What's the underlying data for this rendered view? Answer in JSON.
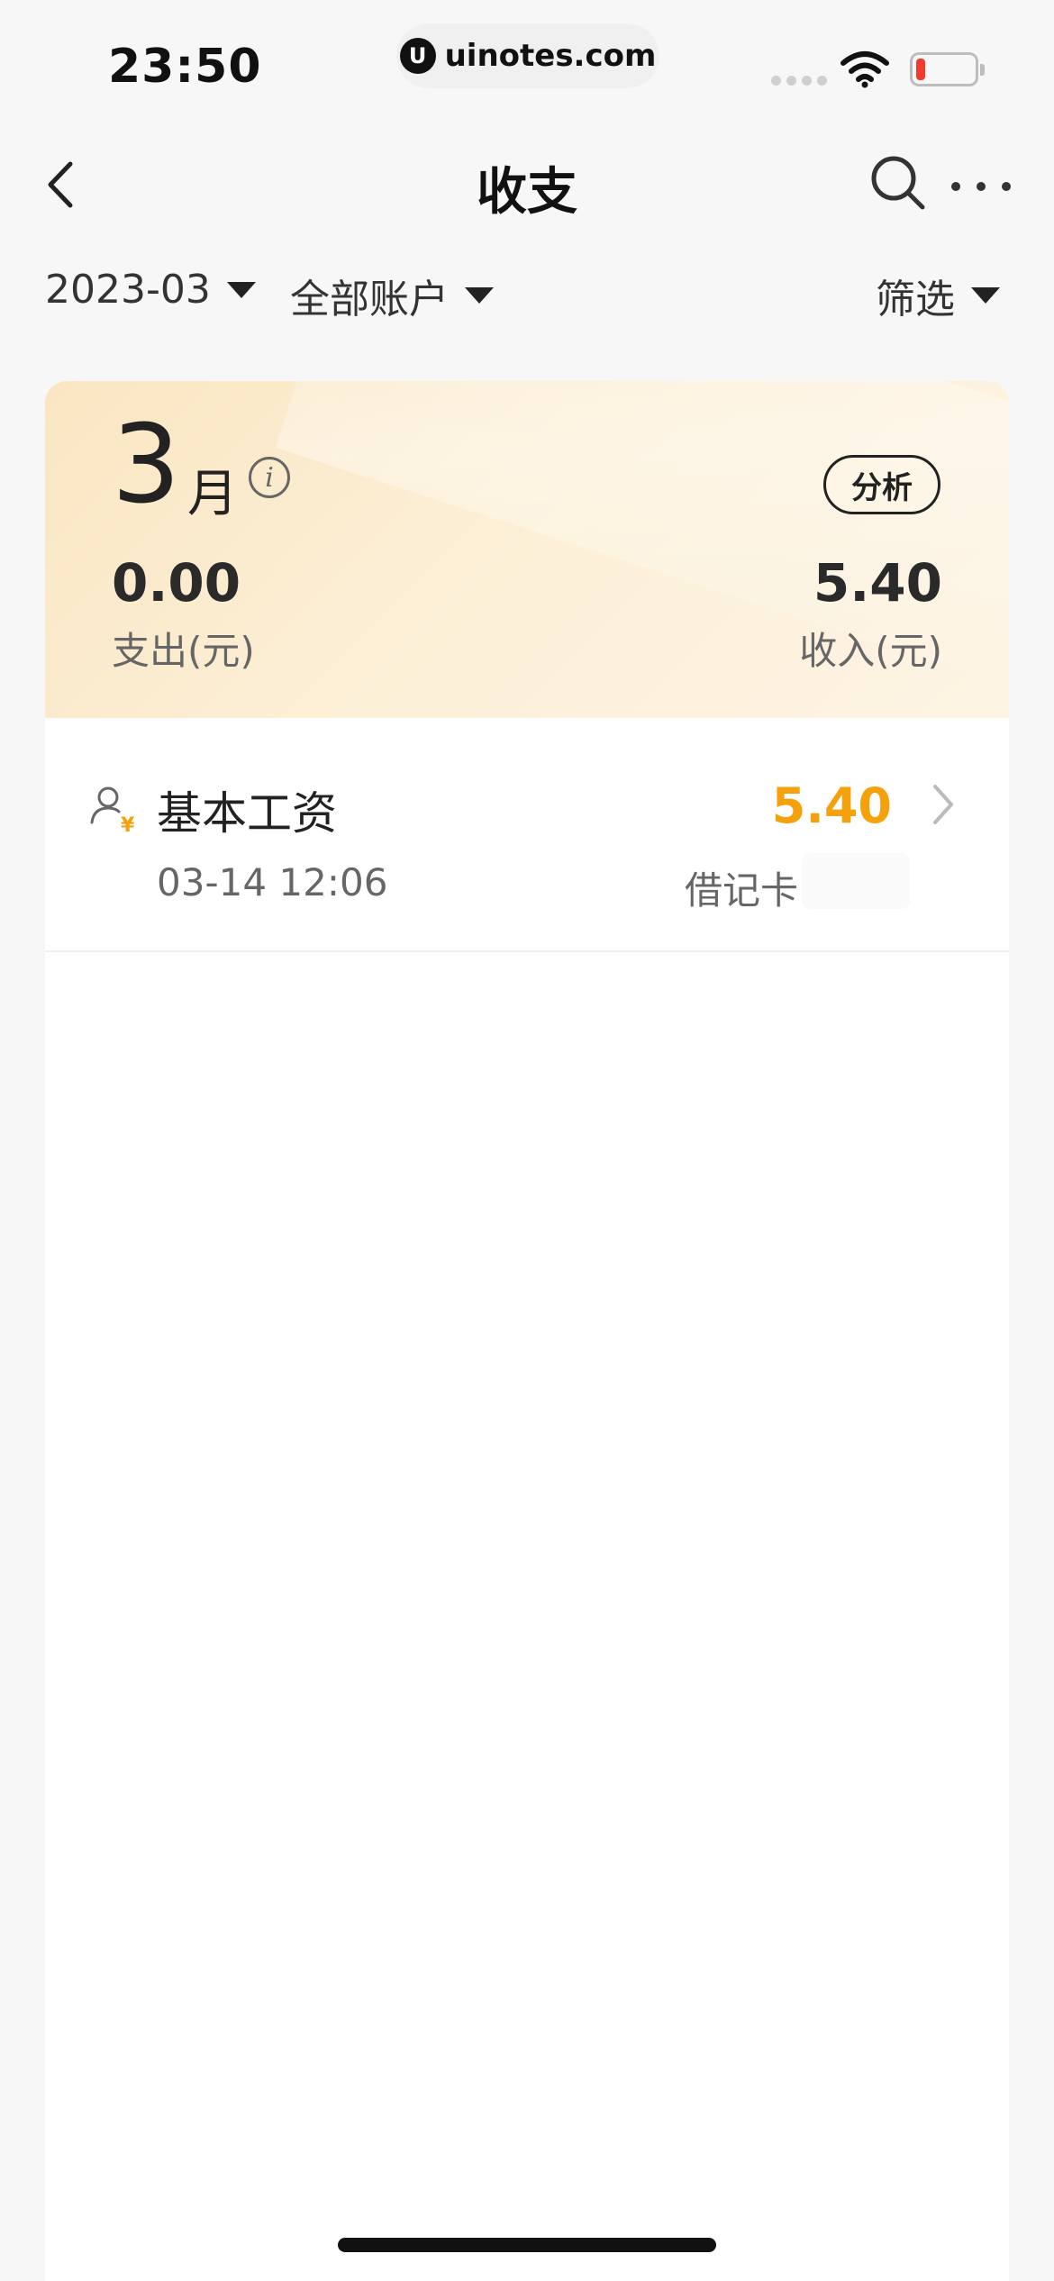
{
  "status_bar": {
    "time": "23:50",
    "url": "uinotes.com",
    "battery_color": "#f23b30"
  },
  "nav": {
    "title": "收支",
    "back_icon": "chevron-left-icon",
    "search_icon": "search-icon",
    "more_icon": "more-dots-icon"
  },
  "filters": {
    "month": "2023-03",
    "account": "全部账户",
    "filter_label": "筛选"
  },
  "summary": {
    "month_number": "3",
    "month_unit": "月",
    "info_icon": "i",
    "analysis_label": "分析",
    "expense_amount": "0.00",
    "expense_label": "支出(元)",
    "income_amount": "5.40",
    "income_label": "收入(元)"
  },
  "transactions": [
    {
      "name": "基本工资",
      "amount": "5.40",
      "time": "03-14 12:06",
      "account": "借记卡",
      "icon": "salary-person-icon"
    }
  ],
  "colors": {
    "income_accent": "#f5a10c",
    "summary_bg": "#fae6c2"
  }
}
